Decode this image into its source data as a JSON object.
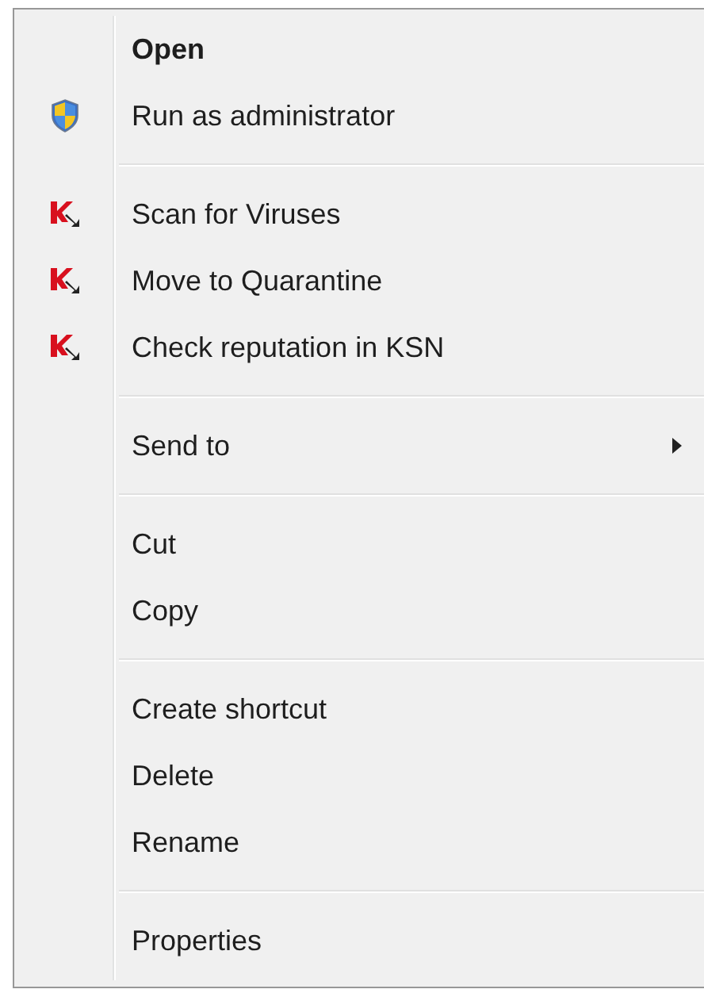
{
  "menu": {
    "items": [
      {
        "kind": "plain",
        "label": "Open",
        "default": true
      },
      {
        "kind": "elevated",
        "label": "Run as administrator",
        "default": false
      },
      {
        "kind": "separator"
      },
      {
        "kind": "antivirus",
        "label": "Scan for Viruses",
        "default": false
      },
      {
        "kind": "antivirus",
        "label": "Move to Quarantine",
        "default": false
      },
      {
        "kind": "antivirus",
        "label": "Check reputation in KSN",
        "default": false
      },
      {
        "kind": "separator"
      },
      {
        "kind": "submenu",
        "label": "Send to",
        "default": false
      },
      {
        "kind": "separator"
      },
      {
        "kind": "plain",
        "label": "Cut",
        "default": false
      },
      {
        "kind": "plain",
        "label": "Copy",
        "default": false
      },
      {
        "kind": "separator"
      },
      {
        "kind": "plain",
        "label": "Create shortcut",
        "default": false
      },
      {
        "kind": "plain",
        "label": "Delete",
        "default": false
      },
      {
        "kind": "plain",
        "label": "Rename",
        "default": false
      },
      {
        "kind": "separator"
      },
      {
        "kind": "plain",
        "label": "Properties",
        "default": false
      }
    ]
  }
}
